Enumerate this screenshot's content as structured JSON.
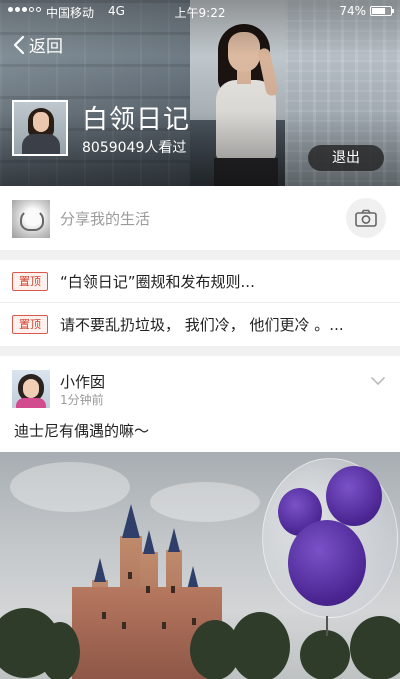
{
  "status_bar": {
    "carrier": "中国移动",
    "network": "4G",
    "time": "上午9:22",
    "battery_percent": "74%",
    "battery_level": 0.74
  },
  "nav": {
    "back_label": "返回"
  },
  "group": {
    "name": "白领日记",
    "views": "8059049人看过",
    "quit_label": "退出"
  },
  "share": {
    "placeholder": "分享我的生活"
  },
  "pinned": [
    {
      "badge": "置顶",
      "text": "“白领日记”圈规和发布规则..."
    },
    {
      "badge": "置顶",
      "text": "请不要乱扔垃圾，   我们冷，   他们更冷  。..."
    }
  ],
  "post": {
    "author": "小作囡",
    "time_ago": "1分钟前",
    "content": "迪士尼有偶遇的嘛～"
  }
}
